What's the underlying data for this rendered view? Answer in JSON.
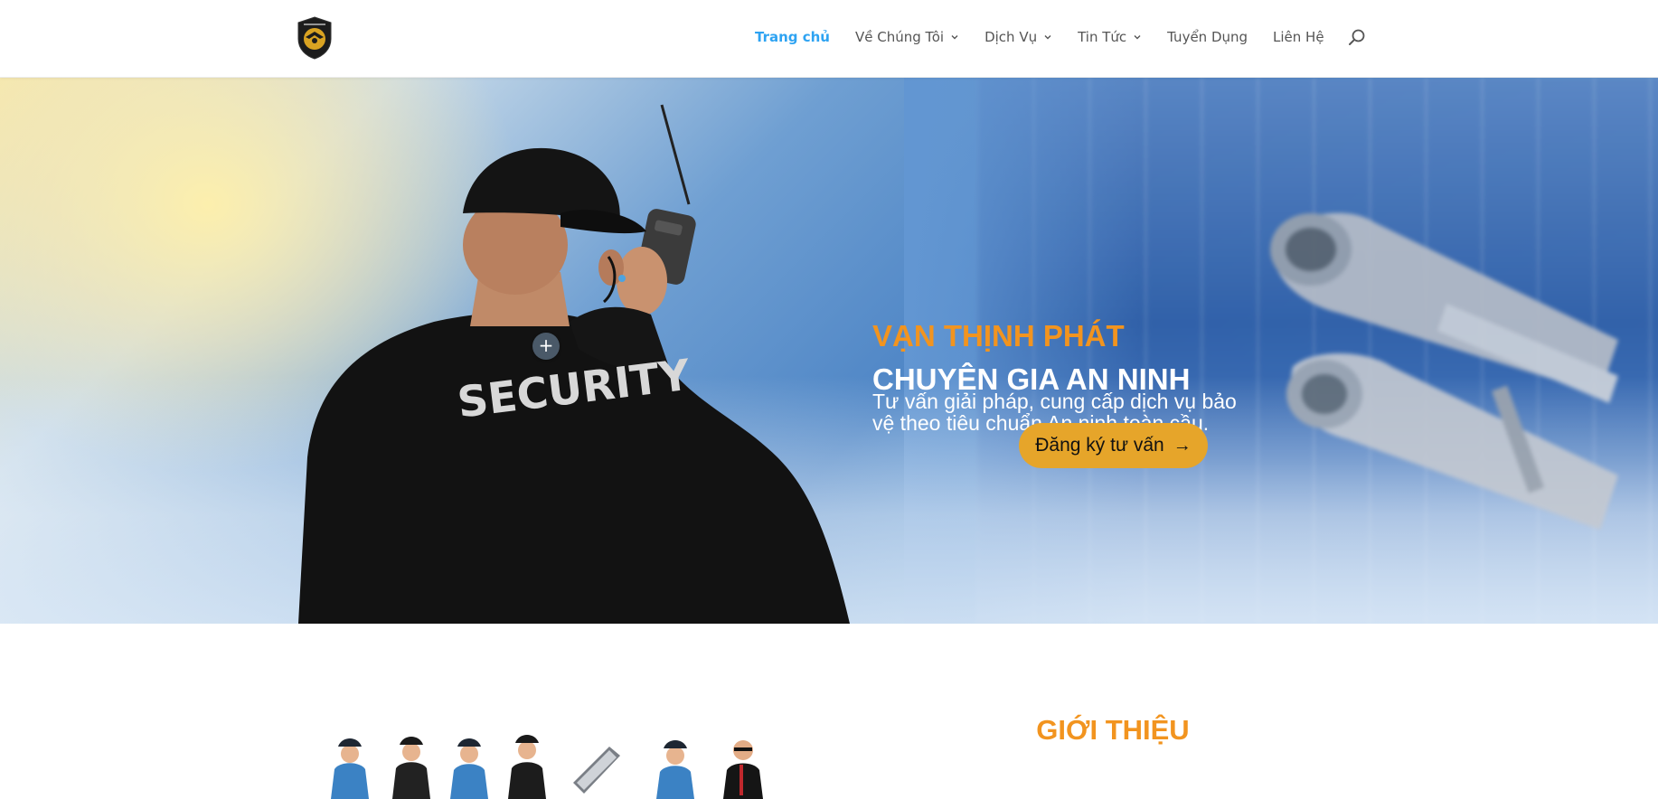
{
  "header": {
    "logo_icon": "shield-eagle-logo",
    "nav": [
      {
        "label": "Trang chủ",
        "active": true,
        "has_dropdown": false
      },
      {
        "label": "Về Chúng Tôi",
        "active": false,
        "has_dropdown": true
      },
      {
        "label": "Dịch Vụ",
        "active": false,
        "has_dropdown": true
      },
      {
        "label": "Tin Tức",
        "active": false,
        "has_dropdown": true
      },
      {
        "label": "Tuyển Dụng",
        "active": false,
        "has_dropdown": false
      },
      {
        "label": "Liên Hệ",
        "active": false,
        "has_dropdown": false
      }
    ],
    "search_icon": "search-icon",
    "active_color": "#2ea3f2"
  },
  "hero": {
    "title_line1": "VẠN THỊNH PHÁT",
    "title_line2": "CHUYÊN GIA AN NINH",
    "description": "Tư vấn giải pháp, cung cấp dịch vụ bảo vệ theo tiêu chuẩn An ninh toàn cầu.",
    "cta_label": "Đăng ký tư vấn",
    "cta_icon": "arrow-right-icon",
    "jacket_text": "SECURITY",
    "plus_label": "+",
    "accent_color": "#f2941f",
    "button_color": "#e6a52a"
  },
  "intro": {
    "title": "GIỚI THIỆU",
    "icons": [
      "guard-icon",
      "guard-icon",
      "guard-icon",
      "guard-icon",
      "keypad-icon",
      "guard-icon",
      "bodyguard-icon"
    ]
  }
}
